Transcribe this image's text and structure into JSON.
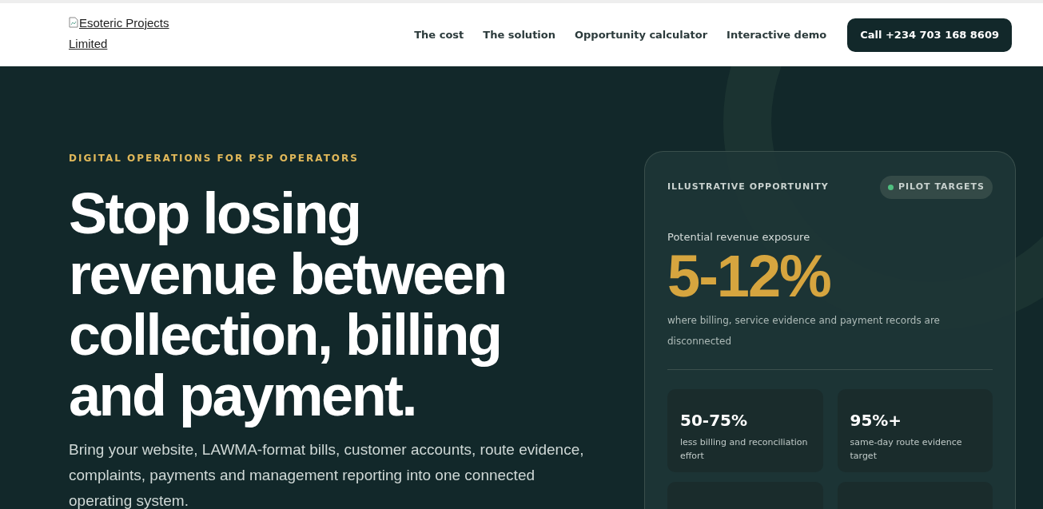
{
  "header": {
    "logo_alt": "Esoteric Projects Limited",
    "nav": [
      "The cost",
      "The solution",
      "Opportunity calculator",
      "Interactive demo"
    ],
    "cta": "Call +234 703 168 8609"
  },
  "hero": {
    "eyebrow": "DIGITAL OPERATIONS FOR PSP OPERATORS",
    "headline": "Stop losing revenue between collection, billing and payment.",
    "body": "Bring your website, LAWMA-format bills, customer accounts, route evidence, complaints, payments and management reporting into one connected operating system."
  },
  "card": {
    "label": "ILLUSTRATIVE OPPORTUNITY",
    "badge": {
      "text": "PILOT TARGETS",
      "color": "#4fbf7f"
    },
    "caption": "Potential revenue exposure",
    "figure": "5-12%",
    "note": "where billing, service evidence and payment records are disconnected",
    "stats": [
      {
        "kind": "stat",
        "value": "50-75%",
        "label": "less billing and reconciliation effort"
      },
      {
        "kind": "stat",
        "value": "95%+",
        "label": "same-day route evidence target"
      },
      {
        "kind": "clipped"
      },
      {
        "kind": "clipped"
      }
    ]
  }
}
